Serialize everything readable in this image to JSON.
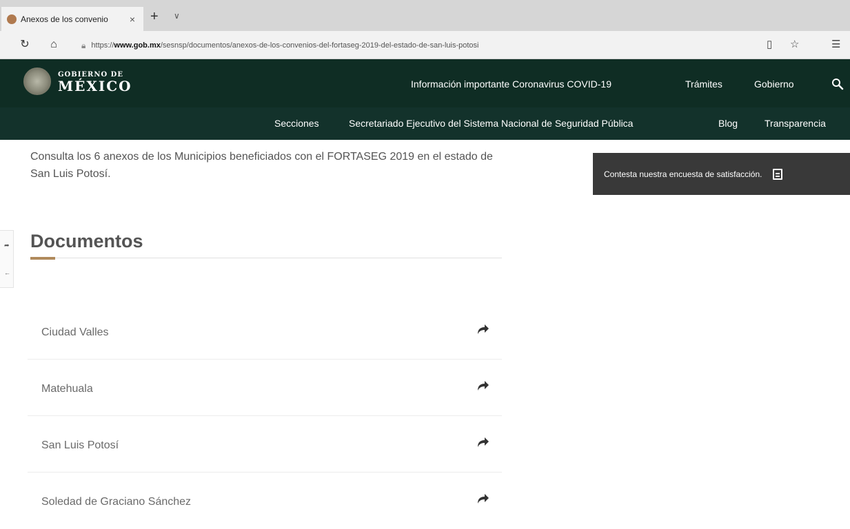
{
  "browser": {
    "tab_title": "Anexos de los convenio",
    "tab_close": "×",
    "new_tab": "+",
    "tab_menu": "∨",
    "url_scheme": "https://",
    "url_host": "www.gob.mx",
    "url_path": "/sesnsp/documentos/anexos-de-los-convenios-del-fortaseg-2019-del-estado-de-san-luis-potosi",
    "icons": [
      "refresh-icon",
      "home-icon",
      "lock-icon",
      "reading-view-icon",
      "favorite-star-icon",
      "favorites-list-icon"
    ]
  },
  "header": {
    "brand_line1": "GOBIERNO DE",
    "brand_line2": "MÉXICO",
    "nav": [
      "Información importante Coronavirus COVID-19",
      "Trámites",
      "Gobierno"
    ],
    "subnav": [
      "Secciones",
      "Secretariado Ejecutivo del Sistema Nacional de Seguridad Pública",
      "Blog",
      "Transparencia"
    ]
  },
  "content": {
    "intro": "Consulta los 6 anexos de los Municipios beneficiados con el FORTASEG 2019 en el estado de San Luis Potosí.",
    "survey_label": "Contesta nuestra encuesta de satisfacción.",
    "section_title": "Documentos",
    "documents": [
      "Ciudad Valles",
      "Matehuala",
      "San Luis Potosí",
      "Soledad de Graciano Sánchez"
    ]
  },
  "colors": {
    "header_bg": "#0f2d24",
    "subnav_bg": "#13322b",
    "accent": "#b08a5c",
    "survey_bg": "#393939"
  }
}
